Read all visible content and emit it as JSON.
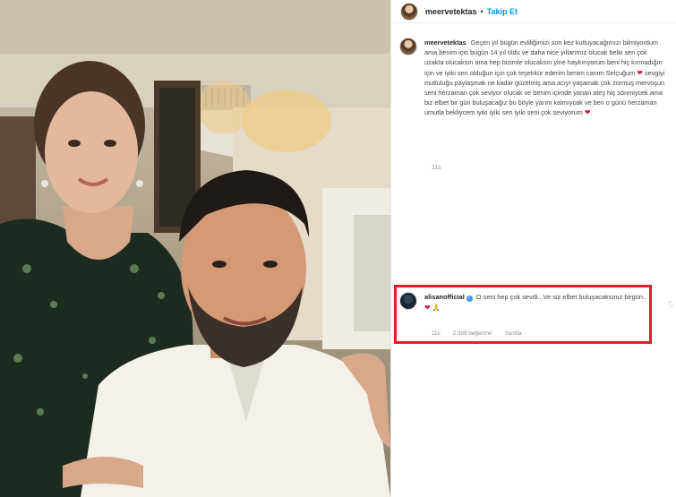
{
  "post": {
    "username": "meervetektas",
    "separator": "•",
    "follow_label": "Takip Et",
    "caption_username": "meervetektas",
    "caption_body": "Geçen yıl bugün evliliğimizi son kez kutluyacağımızı bilmiyordum ama benim için bugün 14 yıl oldu ve daha nice yıllarımız olucak belki sen çok uzakta olucaksın ama hep bizimle olucaksın yine haykırıyorum beni hiç kırmadığın için ve iyiki sen olduğun için çok teşekkür ederim benim canım Selçuğum",
    "caption_body_2": "sevgiyi mutluluğu paylaşmak ne kadar güzelmiş ama acıyı yaşamak çok zormuş mervoşun seni herzaman çok seviyor olucak ve benim içimde yanan ateş hiç sönmiycek ama biz elbet bir gün buluşacağız bu böyle yarım kalmıycak ve ben o günü herzaman umutla bekliycem iyiki iyiki sen iyiki seni çok seviyorum",
    "heart": "❤",
    "time": "11s"
  },
  "comment": {
    "username": "alisanofficial",
    "verified_mark": "✓",
    "text": "O seni hep çok sevdi...Ve siz elbet buluşacaksınız birgün..",
    "emoji_heart": "❤",
    "emoji_pray": "🙏",
    "time": "11s",
    "likes": "2.399 beğenme",
    "reply_label": "Yanıtla",
    "like_icon": "♡"
  },
  "colors": {
    "follow_blue": "#0095f6",
    "highlight_red": "#e41e26",
    "heart_red": "#d0243e"
  }
}
